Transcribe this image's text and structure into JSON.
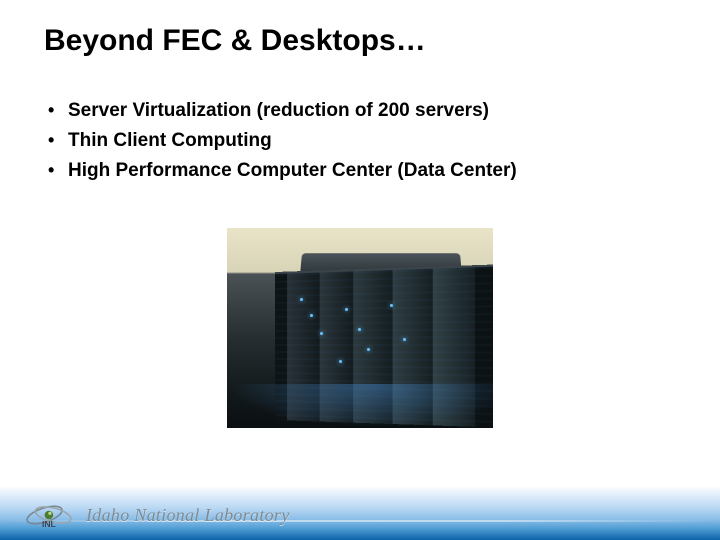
{
  "title": "Beyond FEC & Desktops…",
  "bullets": [
    "Server Virtualization (reduction of 200 servers)",
    "Thin Client Computing",
    "High Performance Computer Center (Data Center)"
  ],
  "footer": {
    "org_name": "Idaho National Laboratory",
    "logo_abbrev": "INL"
  }
}
